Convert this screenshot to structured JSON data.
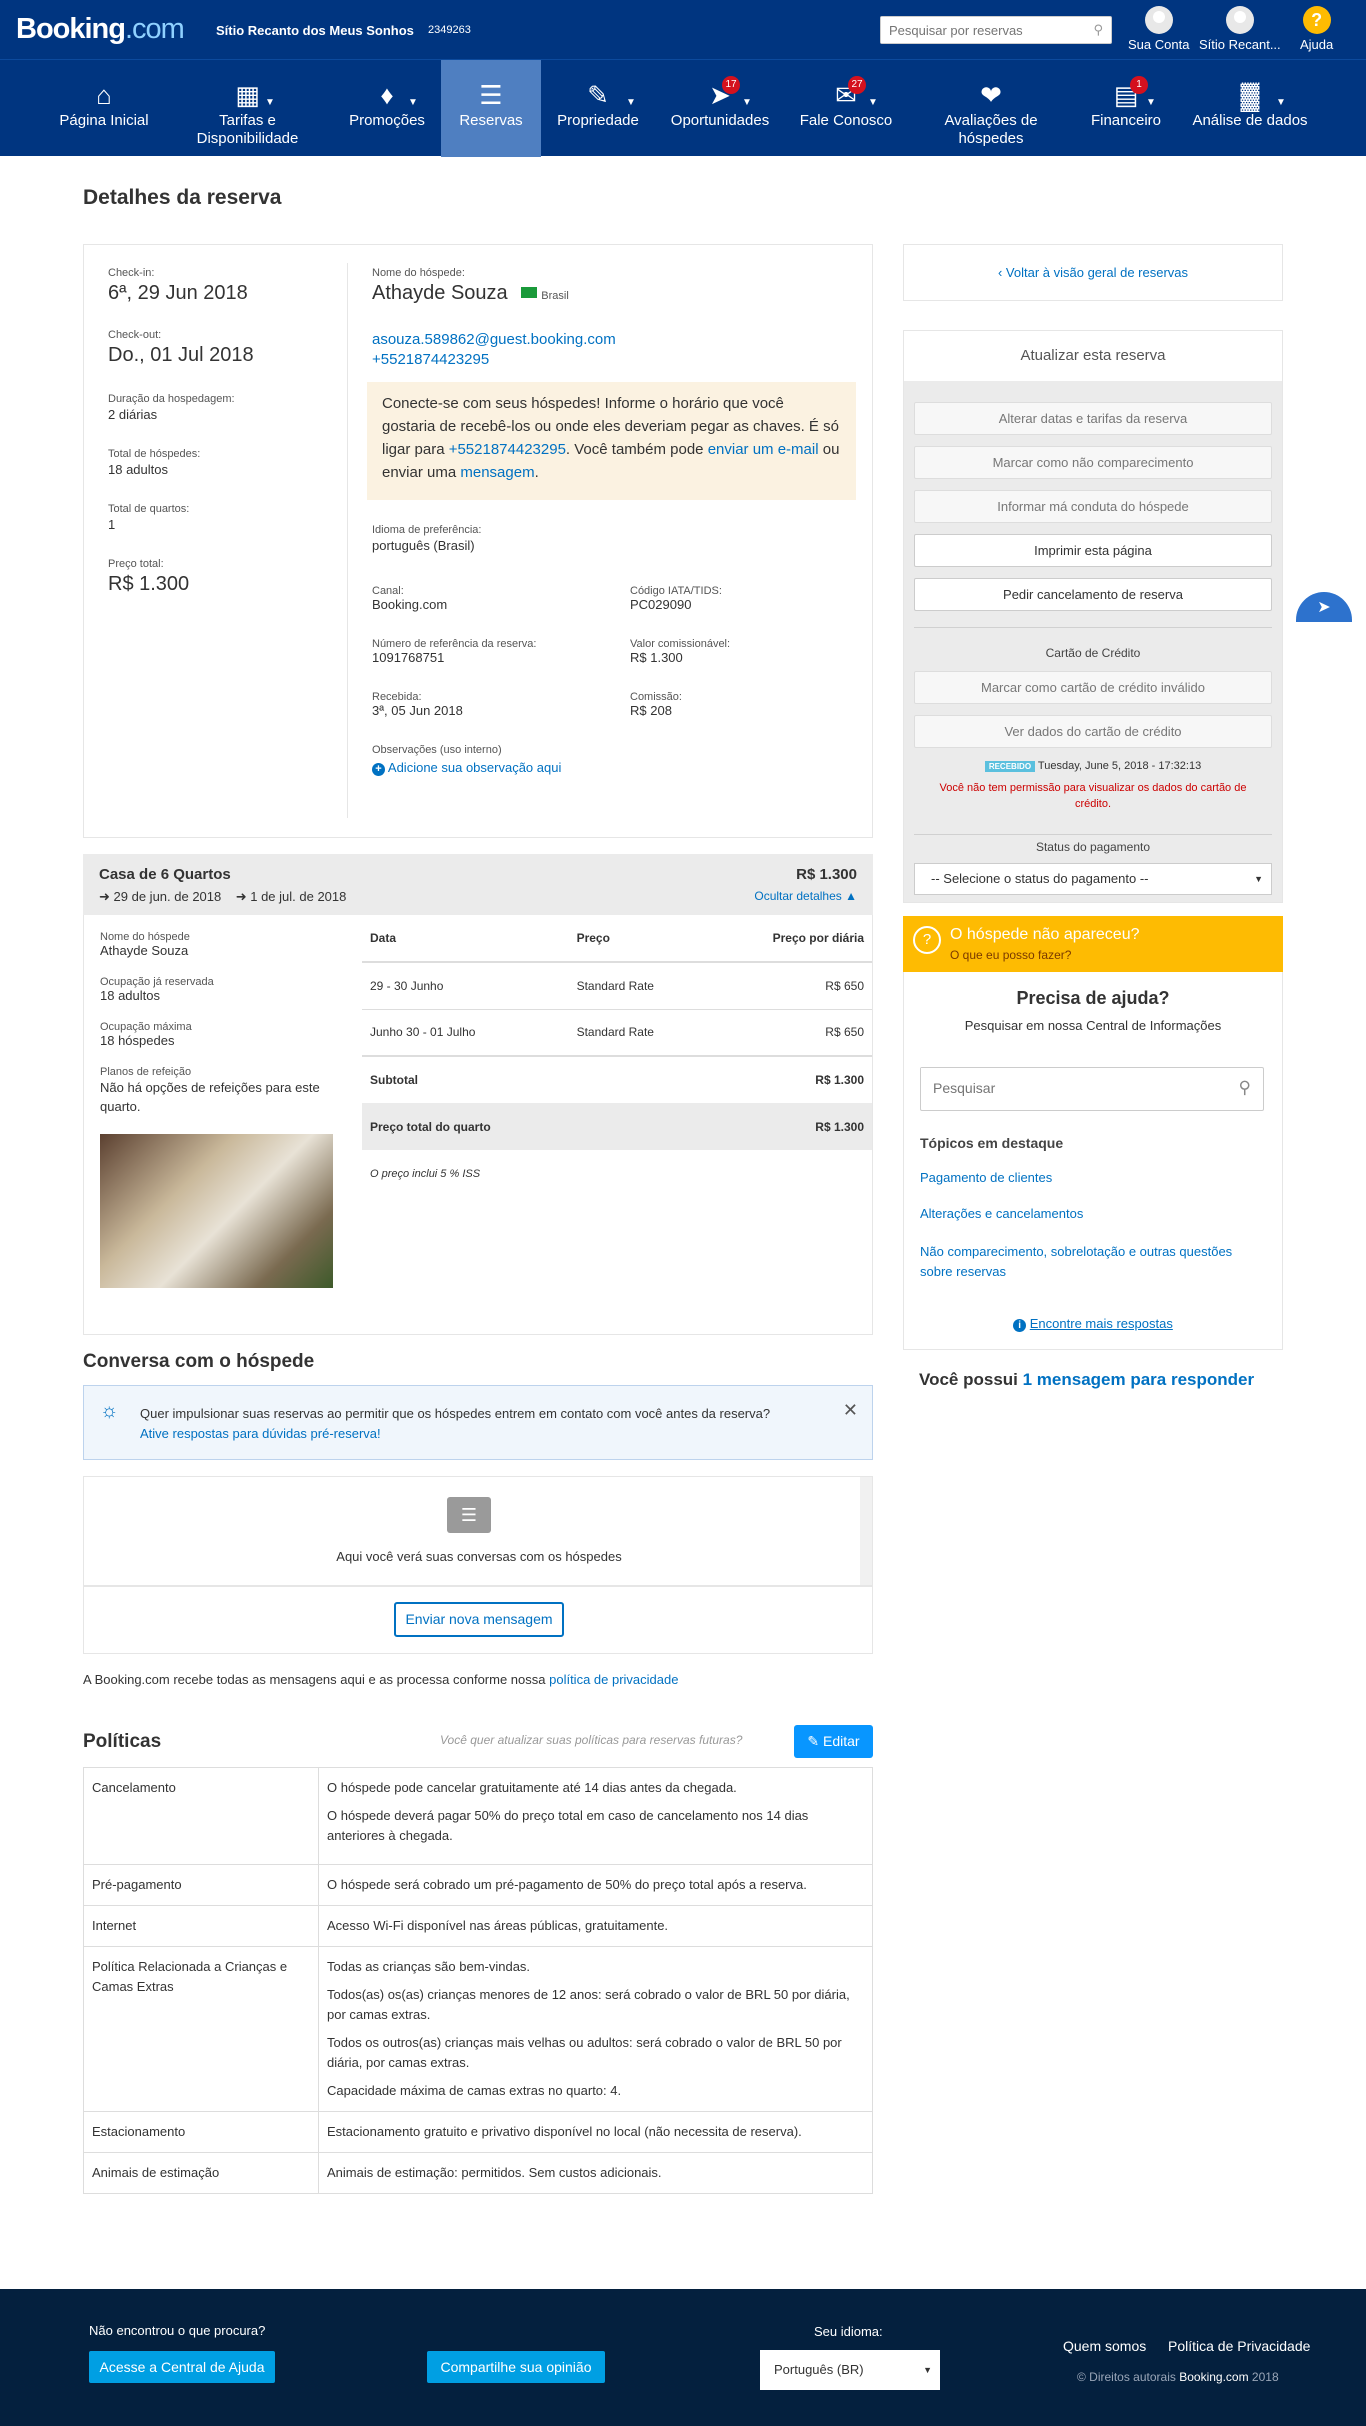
{
  "header": {
    "logo_main": "Booking",
    "logo_com": ".com",
    "property_name": "Sítio Recanto dos Meus Sonhos",
    "property_id": "2349263",
    "search_placeholder": "Pesquisar por reservas",
    "account": "Sua Conta",
    "property_short": "Sítio Recant...",
    "help": "Ajuda"
  },
  "nav": {
    "items": [
      {
        "label": "Página Inicial",
        "icon": "home-icon"
      },
      {
        "label": "Tarifas e Disponibilidade",
        "icon": "calendar-icon"
      },
      {
        "label": "Promoções",
        "icon": "tag-icon"
      },
      {
        "label": "Reservas",
        "icon": "list-icon"
      },
      {
        "label": "Propriedade",
        "icon": "pencil-icon"
      },
      {
        "label": "Oportunidades",
        "icon": "rocket-icon",
        "badge": "17"
      },
      {
        "label": "Fale Conosco",
        "icon": "envelope-icon",
        "badge": "27"
      },
      {
        "label": "Avaliações de hóspedes",
        "icon": "heart-icon"
      },
      {
        "label": "Financeiro",
        "icon": "document-icon",
        "badge": "1"
      },
      {
        "label": "Análise de dados",
        "icon": "bar-chart-icon"
      }
    ]
  },
  "page": {
    "title": "Detalhes da reserva"
  },
  "summary": {
    "checkin_label": "Check-in:",
    "checkin": "6ª, 29 Jun 2018",
    "checkout_label": "Check-out:",
    "checkout": "Do., 01 Jul 2018",
    "duration_label": "Duração da hospedagem:",
    "duration": "2 diárias",
    "guests_label": "Total de hóspedes:",
    "guests": "18 adultos",
    "rooms_label": "Total de quartos:",
    "rooms": "1",
    "price_label": "Preço total:",
    "price": "R$ 1.300"
  },
  "guest": {
    "name_label": "Nome do hóspede:",
    "name": "Athayde Souza",
    "country": "Brasil",
    "email": "asouza.589862@guest.booking.com",
    "phone": "+5521874423295",
    "cta_1": "Conecte-se com seus hóspedes! Informe o horário que você gostaria de recebê-los ou onde eles deveriam pegar as chaves. É só ligar para ",
    "cta_phone": "+5521874423295",
    "cta_2": ". Você também pode ",
    "cta_email": "enviar um e-mail",
    "cta_3": " ou enviar uma ",
    "cta_msg": "mensagem",
    "cta_4": ".",
    "lang_label": "Idioma de preferência:",
    "lang": "português (Brasil)",
    "channel_label": "Canal:",
    "channel": "Booking.com",
    "iata_label": "Código IATA/TIDS:",
    "iata": "PC029090",
    "ref_label": "Número de referência da reserva:",
    "ref": "1091768751",
    "commissionable_label": "Valor comissionável:",
    "commissionable": "R$ 1.300",
    "received_label": "Recebida:",
    "received": "3ª, 05 Jun 2018",
    "commission_label": "Comissão:",
    "commission": "R$ 208",
    "notes_label": "Observações (uso interno)",
    "add_note": "Adicione sua observação aqui"
  },
  "room": {
    "title": "Casa de 6 Quartos",
    "price": "R$ 1.300",
    "checkin": "29 de jun. de 2018",
    "checkout": "1 de jul. de 2018",
    "hide": "Ocultar detalhes",
    "guest_label": "Nome do hóspede",
    "guest": "Athayde Souza",
    "occ_label": "Ocupação já reservada",
    "occ": "18 adultos",
    "max_label": "Ocupação máxima",
    "max": "18 hóspedes",
    "meal_label": "Planos de refeição",
    "meal": "Não há opções de refeições para este quarto.",
    "col_date": "Data",
    "col_price": "Preço",
    "col_night": "Preço por diária",
    "rows": [
      {
        "date": "29 - 30 Junho",
        "rate": "Standard Rate",
        "amount": "R$ 650"
      },
      {
        "date": "Junho 30 - 01 Julho",
        "rate": "Standard Rate",
        "amount": "R$ 650"
      }
    ],
    "subtotal_label": "Subtotal",
    "subtotal": "R$ 1.300",
    "total_label": "Preço total do quarto",
    "total": "R$ 1.300",
    "tax_note": "O preço inclui 5 % ISS"
  },
  "conversation": {
    "title": "Conversa com o hóspede",
    "tip": "Quer impulsionar suas reservas ao permitir que os hóspedes entrem em contato com você antes da reserva?",
    "tip_link": "Ative respostas para dúvidas pré-reserva!",
    "empty": "Aqui você verá suas conversas com os hóspedes",
    "send": "Enviar nova mensagem",
    "privacy_1": "A Booking.com recebe todas as mensagens aqui e as processa conforme nossa ",
    "privacy_link": "política de privacidade"
  },
  "policies": {
    "title": "Políticas",
    "update_q": "Você quer atualizar suas políticas para reservas futuras?",
    "edit": "Editar",
    "rows": [
      {
        "label": "Cancelamento",
        "lines": [
          "O hóspede pode cancelar gratuitamente até 14 dias antes da chegada.",
          "O hóspede deverá pagar 50% do preço total em caso de cancelamento nos 14 dias anteriores à chegada."
        ]
      },
      {
        "label": "Pré-pagamento",
        "lines": [
          "O hóspede será cobrado um pré-pagamento de 50% do preço total após a reserva."
        ]
      },
      {
        "label": "Internet",
        "lines": [
          "Acesso Wi-Fi disponível nas áreas públicas, gratuitamente."
        ]
      },
      {
        "label": "Política Relacionada a Crianças e Camas Extras",
        "lines": [
          "Todas as crianças são bem-vindas.",
          "Todos(as) os(as) crianças menores de 12 anos: será cobrado o valor de BRL 50 por diária, por camas extras.",
          "Todos os outros(as) crianças mais velhas ou adultos: será cobrado o valor de BRL 50 por diária, por camas extras.",
          "Capacidade máxima de camas extras no quarto: 4."
        ]
      },
      {
        "label": "Estacionamento",
        "lines": [
          "Estacionamento gratuito e privativo disponível no local (não necessita de reserva)."
        ]
      },
      {
        "label": "Animais de estimação",
        "lines": [
          "Animais de estimação: permitidos. Sem custos adicionais."
        ]
      }
    ]
  },
  "sidebar": {
    "back": "Voltar à visão geral de reservas",
    "update_title": "Atualizar esta reserva",
    "btn_dates": "Alterar datas e tarifas da reserva",
    "btn_noshow": "Marcar como não comparecimento",
    "btn_misconduct": "Informar má conduta do hóspede",
    "btn_print": "Imprimir esta página",
    "btn_cancel": "Pedir cancelamento de reserva",
    "cc_title": "Cartão de Crédito",
    "btn_invalid": "Marcar como cartão de crédito inválido",
    "btn_view": "Ver dados do cartão de crédito",
    "received_badge": "RECEBIDO",
    "received_time": "Tuesday, June 5, 2018 - 17:32:13",
    "cc_warning": "Você não tem permissão para visualizar os dados do cartão de crédito.",
    "pay_title": "Status do pagamento",
    "pay_select": "-- Selecione o status do pagamento --",
    "noshow_q": "O hóspede não apareceu?",
    "noshow_link": "O que eu posso fazer?",
    "help_title": "Precisa de ajuda?",
    "help_sub": "Pesquisar em nossa Central de Informações",
    "help_placeholder": "Pesquisar",
    "topics_title": "Tópicos em destaque",
    "topics": [
      "Pagamento de clientes",
      "Alterações e cancelamentos",
      "Não comparecimento, sobrelotação e outras questões sobre reservas"
    ],
    "more": "Encontre mais respostas",
    "msg_1": "Você possui ",
    "msg_link": "1 mensagem para responder"
  },
  "footer": {
    "not_found": "Não encontrou o que procura?",
    "help_center": "Acesse a Central de Ajuda",
    "share": "Compartilhe sua opinião",
    "lang_label": "Seu idioma:",
    "lang": "Português (BR)",
    "about": "Quem somos",
    "privacy": "Política de Privacidade",
    "copyright_1": "© Direitos autorais ",
    "copyright_brand": "Booking.com",
    "copyright_year": " 2018"
  },
  "colors": {
    "brand": "#003580",
    "accent": "#0071c2",
    "warning": "#febb02",
    "badge": "#d4111e"
  }
}
